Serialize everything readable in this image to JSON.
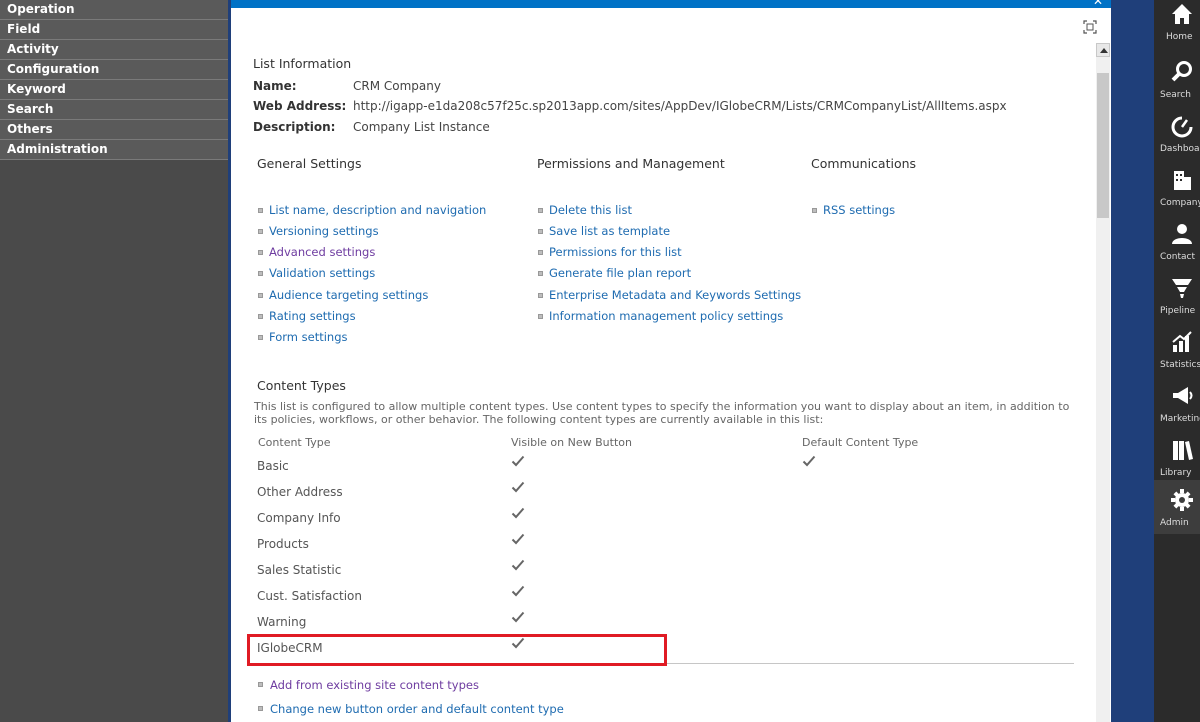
{
  "nav": {
    "items": [
      {
        "label": "Operation"
      },
      {
        "label": "Field"
      },
      {
        "label": "Activity"
      },
      {
        "label": "Configuration"
      },
      {
        "label": "Keyword"
      },
      {
        "label": "Search"
      },
      {
        "label": "Others"
      },
      {
        "label": "Administration"
      }
    ]
  },
  "list_info": {
    "heading": "List Information",
    "name_label": "Name:",
    "name_value": "CRM Company",
    "web_label": "Web Address:",
    "web_value": "http://igapp-e1da208c57f25c.sp2013app.com/sites/AppDev/IGlobeCRM/Lists/CRMCompanyList/AllItems.aspx",
    "desc_label": "Description:",
    "desc_value": "Company List Instance"
  },
  "general": {
    "heading": "General Settings",
    "links": [
      "List name, description and navigation",
      "Versioning settings",
      "Advanced settings",
      "Validation settings",
      "Audience targeting settings",
      "Rating settings",
      "Form settings"
    ]
  },
  "permissions": {
    "heading": "Permissions and Management",
    "links": [
      "Delete this list",
      "Save list as template",
      "Permissions for this list",
      "Generate file plan report",
      "Enterprise Metadata and Keywords Settings",
      "Information management policy settings"
    ]
  },
  "communications": {
    "heading": "Communications",
    "links": [
      "RSS settings"
    ]
  },
  "content_types": {
    "heading": "Content Types",
    "description": "This list is configured to allow multiple content types. Use content types to specify the information you want to display about an item, in addition to its policies, workflows, or other behavior. The following content types are currently available in this list:",
    "col_type": "Content Type",
    "col_visible": "Visible on New Button",
    "col_default": "Default Content Type",
    "rows": [
      {
        "name": "Basic",
        "visible": true,
        "default": true
      },
      {
        "name": "Other Address",
        "visible": true,
        "default": false
      },
      {
        "name": "Company Info",
        "visible": true,
        "default": false
      },
      {
        "name": "Products",
        "visible": true,
        "default": false
      },
      {
        "name": "Sales Statistic",
        "visible": true,
        "default": false
      },
      {
        "name": "Cust. Satisfaction",
        "visible": true,
        "default": false
      },
      {
        "name": "Warning",
        "visible": true,
        "default": false
      },
      {
        "name": "IGlobeCRM",
        "visible": true,
        "default": false
      }
    ],
    "actions": [
      "Add from existing site content types",
      "Change new button order and default content type"
    ]
  },
  "rail": {
    "items": [
      {
        "label": "Home",
        "icon": "home-icon"
      },
      {
        "label": "Search",
        "icon": "search-icon"
      },
      {
        "label": "Dashboard",
        "icon": "dashboard-icon"
      },
      {
        "label": "Company",
        "icon": "company-icon"
      },
      {
        "label": "Contact",
        "icon": "contact-icon"
      },
      {
        "label": "Pipeline",
        "icon": "pipeline-icon"
      },
      {
        "label": "Statistics",
        "icon": "statistics-icon"
      },
      {
        "label": "Marketing",
        "icon": "marketing-icon"
      },
      {
        "label": "Library",
        "icon": "library-icon"
      },
      {
        "label": "Admin",
        "icon": "gear-icon"
      }
    ],
    "active": "Admin"
  },
  "colors": {
    "accent": "#0072c6",
    "link": "#1e6bb0",
    "visited_link": "#6e3ca0",
    "highlight": "#e01b24"
  }
}
